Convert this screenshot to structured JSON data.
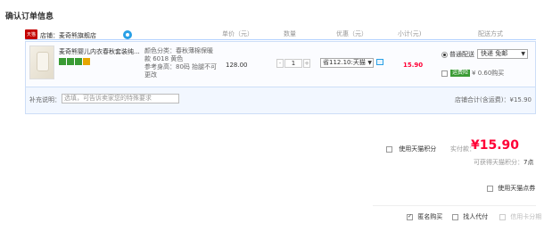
{
  "page": {
    "title": "确认订单信息"
  },
  "headers": {
    "unit_price": "单价（元）",
    "quantity": "数量",
    "discount": "优惠（元）",
    "subtotal": "小计(元)",
    "shipping": "配送方式"
  },
  "store": {
    "icon_text": "天猫",
    "label": "店铺：麦奇熊旗舰店",
    "icon": "wangwang-chat-icon"
  },
  "item": {
    "title": "麦奇熊婴儿内衣春秋套装纯...",
    "props": "颜色分类：春秋薄棉保暖款 6018 黄色\n参考身高：80码 抬腿不可更改",
    "unit_price": "128.00",
    "quantity": "1",
    "qty_minus": "-",
    "qty_plus": "+",
    "coupon_select": "省112.10:天猫",
    "subtotal": "15.90",
    "badges": [
      "#3a9b34",
      "#3a9b34",
      "#3a9b34",
      "#e6a600"
    ]
  },
  "shipping": {
    "method_label": "普通配送",
    "method_select": "快递 免邮",
    "freight_tag": "运费险",
    "freight_text": "¥ 0.60购买"
  },
  "memo": {
    "label": "补充说明：",
    "placeholder": "选填，可告诉卖家您的特殊要求",
    "store_total": "店铺合计(含运费)：¥15.90"
  },
  "summary": {
    "use_points": "使用天猫积分",
    "paid_label": "实付款：",
    "paid_value": "¥15.90",
    "earn_label": "可获得天猫积分：",
    "earn_value": "7点",
    "use_coupon": "使用天猫点券"
  },
  "footer": {
    "anonymous": "匿名购买",
    "find_payer": "找人代付",
    "credit_card": "信用卡分期"
  },
  "colors": {
    "accent": "#ff0036",
    "brand": "#c40000",
    "border": "#cddef7"
  }
}
